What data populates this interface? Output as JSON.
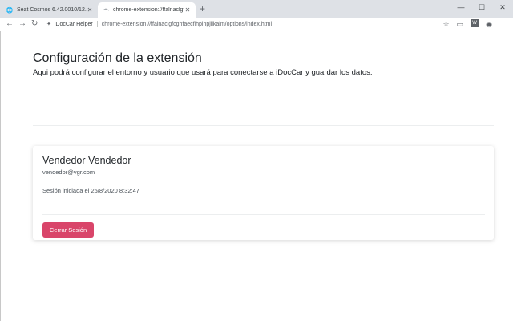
{
  "browser": {
    "tabs": [
      {
        "title": "Seat Cosmos 6.42.0010/12.11.1183",
        "active": false,
        "icon": "globe-icon"
      },
      {
        "title": "chrome-extension://ffalnaclgfcgh...",
        "active": true,
        "icon": "extension-tab-icon"
      }
    ],
    "newtab_symbol": "+",
    "window_controls": {
      "minimize": "—",
      "restore": "☐",
      "close": "✕"
    },
    "nav": {
      "back": "←",
      "forward": "→",
      "reload": "↻"
    },
    "extension_chip": "iDocCar Helper",
    "url": "chrome-extension://ffalnaclgfcghfaecfihpihpjlikalm/options/index.html"
  },
  "page": {
    "title": "Configuración de la extensión",
    "lead": "Aqui podrá configurar el entorno y usuario que usará para conectarse a iDocCar y guardar los datos.",
    "user_card": {
      "name": "Vendedor Vendedor",
      "email": "vendedor@vgr.com",
      "session": "Sesión iniciada el 25/8/2020 8:32:47",
      "logout_label": "Cerrar Sesión"
    }
  },
  "colors": {
    "tabstrip": "#dee1e6",
    "logout_button": "#d9456a",
    "text": "#212529"
  }
}
